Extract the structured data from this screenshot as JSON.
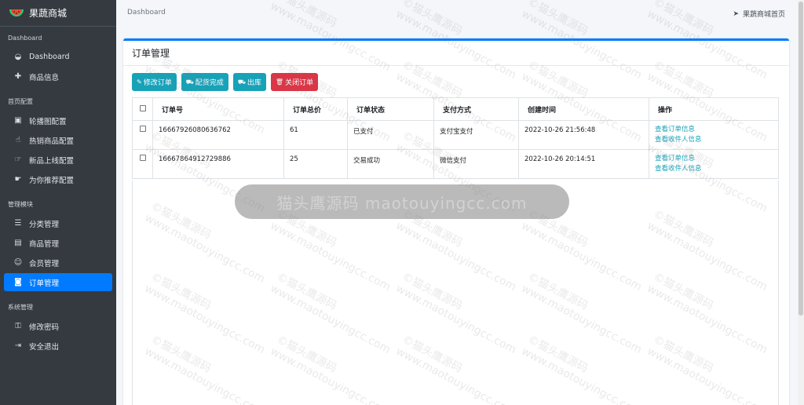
{
  "app": {
    "brand": "果蔬商城"
  },
  "sidebar": {
    "sections": [
      {
        "header": "Dashboard",
        "items": [
          {
            "icon": "dashboard-icon",
            "glyph": "◒",
            "label": "Dashboard"
          },
          {
            "icon": "plus-icon",
            "glyph": "✚",
            "label": "商品信息"
          }
        ]
      },
      {
        "header": "首页配置",
        "items": [
          {
            "icon": "image-icon",
            "glyph": "▣",
            "label": "轮播图配置"
          },
          {
            "icon": "thumbs-up-icon",
            "glyph": "☝",
            "label": "热销商品配置"
          },
          {
            "icon": "pointer-icon",
            "glyph": "☞",
            "label": "新品上线配置"
          },
          {
            "icon": "hand-icon",
            "glyph": "☛",
            "label": "为你推荐配置"
          }
        ]
      },
      {
        "header": "管理模块",
        "items": [
          {
            "icon": "list-icon",
            "glyph": "☰",
            "label": "分类管理"
          },
          {
            "icon": "box-icon",
            "glyph": "▤",
            "label": "商品管理"
          },
          {
            "icon": "users-icon",
            "glyph": "☺",
            "label": "会员管理"
          },
          {
            "icon": "money-icon",
            "glyph": "◙",
            "label": "订单管理",
            "active": true
          }
        ]
      },
      {
        "header": "系统管理",
        "items": [
          {
            "icon": "lock-icon",
            "glyph": "⚿",
            "label": "修改密码"
          },
          {
            "icon": "sign-out-icon",
            "glyph": "⇥",
            "label": "安全退出"
          }
        ]
      }
    ]
  },
  "topbar": {
    "breadcrumb": "Dashboard",
    "home_link": "果蔬商城首页",
    "home_icon": "paper-plane-icon"
  },
  "card": {
    "title": "订单管理"
  },
  "toolbar": [
    {
      "name": "edit-order-button",
      "icon": "edit-icon",
      "glyph": "✎",
      "label": "修改订单",
      "style": "info"
    },
    {
      "name": "stock-complete-button",
      "icon": "truck-icon",
      "glyph": "⛟",
      "label": "配货完成",
      "style": "info"
    },
    {
      "name": "ship-out-button",
      "icon": "truck-icon",
      "glyph": "⛟",
      "label": "出库",
      "style": "info"
    },
    {
      "name": "close-order-button",
      "icon": "trash-icon",
      "glyph": "🗑",
      "label": "关闭订单",
      "style": "danger"
    }
  ],
  "table": {
    "columns": [
      "订单号",
      "订单总价",
      "订单状态",
      "支付方式",
      "创建时间",
      "操作"
    ],
    "rows": [
      {
        "order_no": "16667926080636762",
        "total": "61",
        "status": "已支付",
        "payment": "支付宝支付",
        "created": "2022-10-26 21:56:48",
        "actions": [
          "查看订单信息",
          "查看收件人信息"
        ]
      },
      {
        "order_no": "16667864912729886",
        "total": "25",
        "status": "交易成功",
        "payment": "微信支付",
        "created": "2022-10-26 20:14:51",
        "actions": [
          "查看订单信息",
          "查看收件人信息"
        ]
      }
    ]
  },
  "watermark": {
    "pill_text": "猫头鹰源码 maotouyingcc.com",
    "tile_line1": "©猫头鹰源码",
    "tile_line2": "www.maotouyingcc.com"
  },
  "colors": {
    "sidebar": "#343a40",
    "primary": "#007bff",
    "info": "#17a2b8",
    "danger": "#dc3545"
  }
}
